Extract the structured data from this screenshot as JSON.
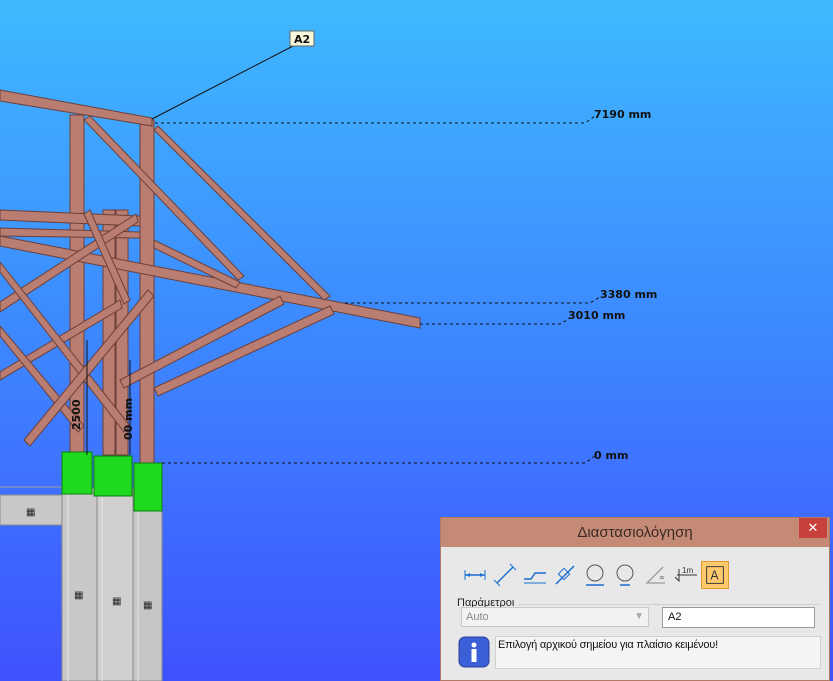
{
  "viewport": {
    "callout_label": "A2",
    "dimensions": [
      "7190 mm",
      "3380 mm",
      "3010 mm",
      "0 mm"
    ],
    "vertical_dim_left": "2500",
    "vertical_dim_right": "00 mm"
  },
  "dialog": {
    "title": "Διαστασιολόγηση",
    "close": "✕",
    "tools": [
      {
        "icon": "linear-dimension-icon"
      },
      {
        "icon": "aligned-dimension-icon"
      },
      {
        "icon": "horizontal-offset-dimension-icon"
      },
      {
        "icon": "diagonal-offset-dimension-icon"
      },
      {
        "icon": "diameter-dimension-icon"
      },
      {
        "icon": "radius-dimension-icon"
      },
      {
        "icon": "angle-dimension-icon"
      },
      {
        "icon": "elevation-dimension-icon"
      },
      {
        "icon": "text-label-icon"
      }
    ],
    "parameters_label": "Παράμετροι",
    "select_value": "Auto",
    "text_value": "A2",
    "message": "Επιλογή αρχικού σημείου για πλαίσιο κειμένου!"
  },
  "colors": {
    "steel": "#b97d72",
    "steel_edge": "#6d3f38",
    "support": "#1fd91f",
    "concrete": "#c8c8c8",
    "titlebar": "#c58a76",
    "close": "#c7413a",
    "active_tool": "#ffc96e"
  }
}
